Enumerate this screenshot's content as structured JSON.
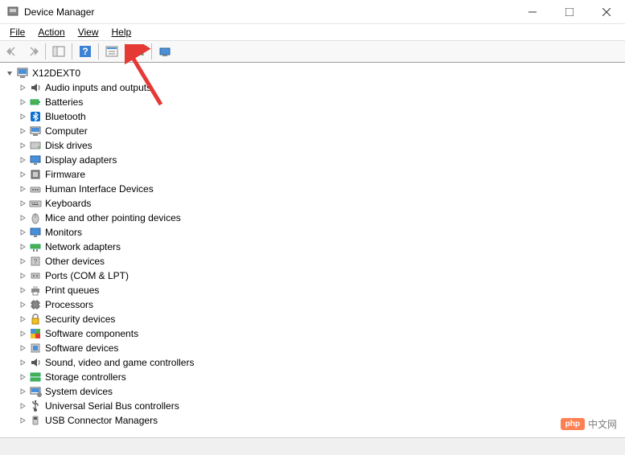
{
  "window": {
    "title": "Device Manager"
  },
  "menu": {
    "file": "File",
    "action": "Action",
    "view": "View",
    "help": "Help"
  },
  "tree": {
    "root": "X12DEXT0",
    "items": [
      {
        "label": "Audio inputs and outputs",
        "icon": "audio"
      },
      {
        "label": "Batteries",
        "icon": "battery"
      },
      {
        "label": "Bluetooth",
        "icon": "bluetooth"
      },
      {
        "label": "Computer",
        "icon": "computer"
      },
      {
        "label": "Disk drives",
        "icon": "disk"
      },
      {
        "label": "Display adapters",
        "icon": "display"
      },
      {
        "label": "Firmware",
        "icon": "firmware"
      },
      {
        "label": "Human Interface Devices",
        "icon": "hid"
      },
      {
        "label": "Keyboards",
        "icon": "keyboard"
      },
      {
        "label": "Mice and other pointing devices",
        "icon": "mouse"
      },
      {
        "label": "Monitors",
        "icon": "monitor"
      },
      {
        "label": "Network adapters",
        "icon": "network"
      },
      {
        "label": "Other devices",
        "icon": "other"
      },
      {
        "label": "Ports (COM & LPT)",
        "icon": "port"
      },
      {
        "label": "Print queues",
        "icon": "printer"
      },
      {
        "label": "Processors",
        "icon": "processor"
      },
      {
        "label": "Security devices",
        "icon": "security"
      },
      {
        "label": "Software components",
        "icon": "software"
      },
      {
        "label": "Software devices",
        "icon": "softdev"
      },
      {
        "label": "Sound, video and game controllers",
        "icon": "sound"
      },
      {
        "label": "Storage controllers",
        "icon": "storage"
      },
      {
        "label": "System devices",
        "icon": "system"
      },
      {
        "label": "Universal Serial Bus controllers",
        "icon": "usb"
      },
      {
        "label": "USB Connector Managers",
        "icon": "usbconn"
      }
    ]
  },
  "watermark": {
    "badge": "php",
    "text": "中文网"
  }
}
